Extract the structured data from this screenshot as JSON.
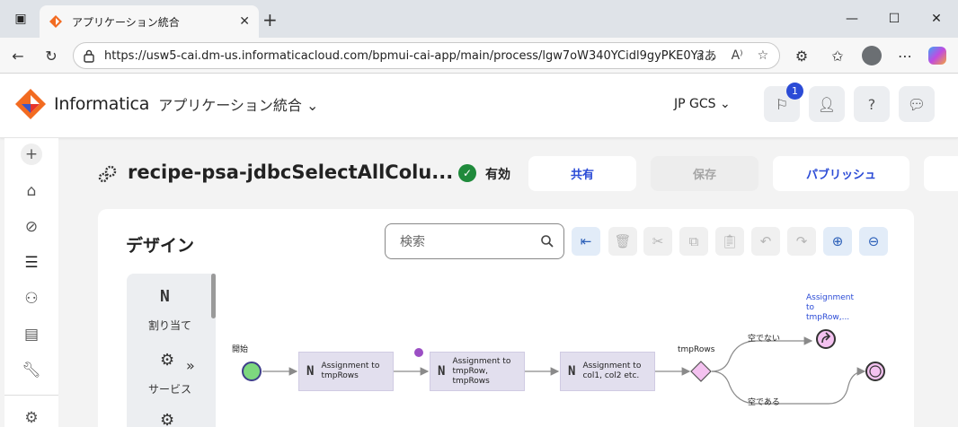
{
  "browser": {
    "tab_title": "アプリケーション統合",
    "url": "https://usw5-cai.dm-us.informaticacloud.com/bpmui-cai-app/main/process/lgw7oW340YCidl9gyPKE0Y?..."
  },
  "header": {
    "brand_name": "Informatica",
    "app_name": "アプリケーション統合",
    "org": "JP GCS",
    "notification_count": "1",
    "help_label": "?"
  },
  "process": {
    "title": "recipe-psa-jdbcSelectAllColu...",
    "status": "有効",
    "share_label": "共有",
    "save_label": "保存",
    "publish_label": "パブリッシュ"
  },
  "design": {
    "title": "デザイン",
    "search_placeholder": "検索"
  },
  "palette": {
    "items": [
      {
        "label": "割り当て"
      },
      {
        "label": "サービス"
      }
    ]
  },
  "canvas": {
    "start_label": "開始",
    "steps": [
      {
        "text": "Assignment to tmpRows"
      },
      {
        "text": "Assignment to tmpRow, tmpRows"
      },
      {
        "text": "Assignment to col1, col2 etc."
      }
    ],
    "decision_label": "tmpRows",
    "branch_not_empty": "空でない",
    "branch_empty": "空である",
    "jump_target": "Assignment to tmpRow,..."
  },
  "colors": {
    "accent": "#2b4bd6",
    "step_fill": "#e2dfee",
    "start_fill": "#7dd87f",
    "decision_fill": "#f4c2f0"
  }
}
